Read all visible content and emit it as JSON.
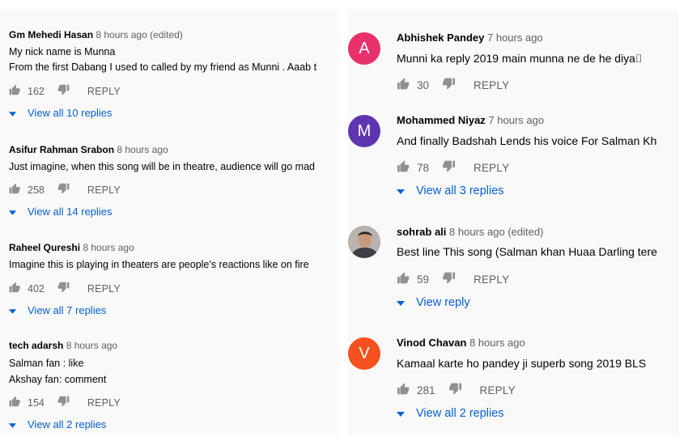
{
  "left": {
    "comments": [
      {
        "author": "Gm Mehedi Hasan",
        "time": "8 hours ago (edited)",
        "lines": [
          "My nick name is Munna",
          "From the first Dabang I used to called by my friend as Munni . Aaab t"
        ],
        "likes": "162",
        "reply_label": "REPLY",
        "view_replies": "View all 10 replies"
      },
      {
        "author": "Asifur Rahman Srabon",
        "time": "8 hours ago",
        "lines": [
          "Just imagine, when this song will be in theatre, audience will go mad"
        ],
        "likes": "258",
        "reply_label": "REPLY",
        "view_replies": "View all 14 replies"
      },
      {
        "author": "Raheel Qureshi",
        "time": "8 hours ago",
        "lines": [
          "Imagine this is playing in theaters are people's reactions like on fire"
        ],
        "likes": "402",
        "reply_label": "REPLY",
        "view_replies": "View all 7 replies"
      },
      {
        "author": "tech adarsh",
        "time": "8 hours ago",
        "lines": [
          "Salman fan :  like",
          "Akshay fan:   comment"
        ],
        "likes": "154",
        "reply_label": "REPLY",
        "view_replies": "View all 2 replies"
      }
    ]
  },
  "right": {
    "comments": [
      {
        "avatar_letter": "A",
        "avatar_color": "#e8316b",
        "author": "Abhishek Pandey",
        "time": "7 hours ago",
        "lines": [
          "Munni ka reply 2019 main munna ne de he diya⌷"
        ],
        "likes": "30",
        "reply_label": "REPLY"
      },
      {
        "avatar_letter": "M",
        "avatar_color": "#5e35b1",
        "author": "Mohammed Niyaz",
        "time": "7 hours ago",
        "lines": [
          "And finally Badshah Lends his voice For Salman Kh"
        ],
        "likes": "78",
        "reply_label": "REPLY",
        "view_replies": "View all 3 replies"
      },
      {
        "avatar_type": "photo",
        "author": "sohrab ali",
        "time": "8 hours ago (edited)",
        "lines": [
          "Best line This song (Salman khan Huaa  Darling tere"
        ],
        "likes": "59",
        "reply_label": "REPLY",
        "view_replies": "View reply"
      },
      {
        "avatar_letter": "V",
        "avatar_color": "#f4511e",
        "author": "Vinod Chavan",
        "time": "8 hours ago",
        "lines": [
          "Kamaal karte ho pandey ji superb song 2019 BLS"
        ],
        "likes": "281",
        "reply_label": "REPLY",
        "view_replies": "View all 2 replies"
      }
    ]
  },
  "colors": {
    "link": "#065fd4",
    "secondary_text": "#606060",
    "panel_bg": "#f9f9f9"
  },
  "icons": {
    "like": "thumbs-up-icon",
    "dislike": "thumbs-down-icon",
    "expand": "caret-down-icon"
  }
}
